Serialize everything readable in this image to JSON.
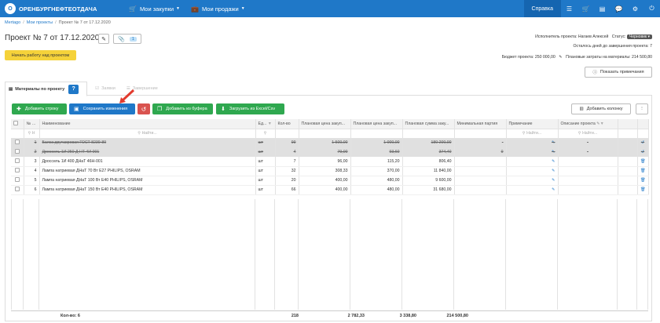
{
  "header": {
    "logo_letter": "О",
    "logo_text": "ОРЕНБУРГНЕФТЕОТДАЧА",
    "nav": [
      {
        "label": "Мои закупки",
        "icon": "cart-icon"
      },
      {
        "label": "Мои продажи",
        "icon": "briefcase-icon"
      }
    ],
    "help_label": "Справка",
    "right_icons": [
      "list-icon",
      "cart-icon",
      "inbox-icon",
      "chat-icon",
      "gear-icon",
      "logout-icon"
    ]
  },
  "breadcrumb": {
    "items": [
      "Mertago",
      "Мои проекты",
      "Проект № 7 от 17.12.2020"
    ]
  },
  "project": {
    "title": "Проект № 7 от 17.12.2020",
    "attach_count": "1",
    "start_button": "Начать работу над проектом",
    "executor": "Исполнитель проекта: Нагаев Алексей",
    "status_label": "Статус:",
    "status_value": "Черновик ▾",
    "days_left": "Осталось дней до завершения проекта: 7",
    "budget": "Бюджет проекта: 250 000,00",
    "planned_costs": "Плановые затраты на материалы: 214 500,80",
    "notes_button": "Показать примечания"
  },
  "tabs": [
    {
      "label": "Материалы по проекту",
      "active": true,
      "badge": "?"
    },
    {
      "label": "Заявки",
      "active": false
    },
    {
      "label": "Завершение",
      "active": false
    }
  ],
  "toolbar": {
    "add_row": "Добавить строку",
    "save": "Сохранить изменения",
    "add_buffer": "Добавить из буфера",
    "load_excel": "Загрузить из Excel/Csv",
    "add_column": "Добавить колонку",
    "more": "⋮"
  },
  "grid": {
    "columns": [
      "№ п/п",
      "Наименование",
      "Ед...",
      "Кол-во",
      "Плановая цена закуп...",
      "Плановая цена закуп...",
      "Плановая сумма заку...",
      "Минимальная партия",
      "Примечание",
      "Описание проекта"
    ],
    "filter_placeholder": "Найти...",
    "filter_short": "Н",
    "rows": [
      {
        "n": "1",
        "name": "Балка двутавровая ГОСТ 8239-89",
        "unit": "шт",
        "qty": "99",
        "p1": "1 500,00",
        "p2": "1 000,00",
        "sum": "180 200,00",
        "min": "-",
        "note": "",
        "desc": "-",
        "deleted": true
      },
      {
        "n": "2",
        "name": "Дроссель 1И 250 Д НТ 4И-001",
        "unit": "шт",
        "qty": "4",
        "p1": "79,00",
        "p2": "93,60",
        "sum": "374,40",
        "min": "0",
        "note": "",
        "desc": "-",
        "deleted": true
      },
      {
        "n": "3",
        "name": "Дроссель 1И 400 ДНаТ 46Н-001",
        "unit": "шт",
        "qty": "7",
        "p1": "96,00",
        "p2": "115,20",
        "sum": "806,40",
        "min": "",
        "note": "",
        "desc": "",
        "deleted": false
      },
      {
        "n": "4",
        "name": "Лампа натриевая ДНаТ 70 Вт Е27 PHILIPS, OSRAM",
        "unit": "шт",
        "qty": "32",
        "p1": "308,33",
        "p2": "370,00",
        "sum": "11 840,00",
        "min": "",
        "note": "",
        "desc": "",
        "deleted": false
      },
      {
        "n": "5",
        "name": "Лампа натриевая ДНаТ 100 Вт Е40 PHILIPS, OSRAM",
        "unit": "шт",
        "qty": "20",
        "p1": "400,00",
        "p2": "480,00",
        "sum": "9 600,00",
        "min": "",
        "note": "",
        "desc": "",
        "deleted": false
      },
      {
        "n": "6",
        "name": "Лампа натриевая ДНаТ 150 Вт Е40 PHILIPS, OSRAM",
        "unit": "шт",
        "qty": "66",
        "p1": "400,00",
        "p2": "480,00",
        "sum": "31 680,00",
        "min": "",
        "note": "",
        "desc": "",
        "deleted": false
      }
    ]
  },
  "totals": {
    "label": "Кол-во: 6",
    "qty": "218",
    "p1": "2 782,33",
    "p2": "3 338,80",
    "sum": "214 500,80"
  }
}
